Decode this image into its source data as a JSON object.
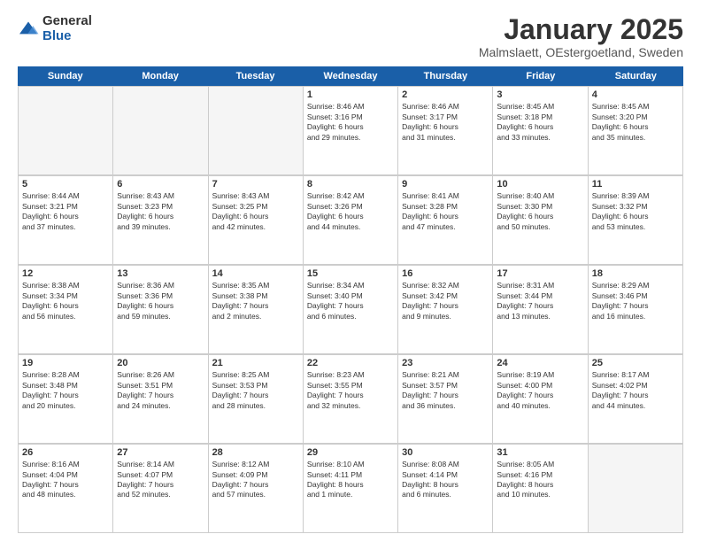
{
  "logo": {
    "general": "General",
    "blue": "Blue"
  },
  "title": "January 2025",
  "subtitle": "Malmslaett, OEstergoetland, Sweden",
  "header_days": [
    "Sunday",
    "Monday",
    "Tuesday",
    "Wednesday",
    "Thursday",
    "Friday",
    "Saturday"
  ],
  "weeks": [
    [
      {
        "day": "",
        "info": ""
      },
      {
        "day": "",
        "info": ""
      },
      {
        "day": "",
        "info": ""
      },
      {
        "day": "1",
        "info": "Sunrise: 8:46 AM\nSunset: 3:16 PM\nDaylight: 6 hours\nand 29 minutes."
      },
      {
        "day": "2",
        "info": "Sunrise: 8:46 AM\nSunset: 3:17 PM\nDaylight: 6 hours\nand 31 minutes."
      },
      {
        "day": "3",
        "info": "Sunrise: 8:45 AM\nSunset: 3:18 PM\nDaylight: 6 hours\nand 33 minutes."
      },
      {
        "day": "4",
        "info": "Sunrise: 8:45 AM\nSunset: 3:20 PM\nDaylight: 6 hours\nand 35 minutes."
      }
    ],
    [
      {
        "day": "5",
        "info": "Sunrise: 8:44 AM\nSunset: 3:21 PM\nDaylight: 6 hours\nand 37 minutes."
      },
      {
        "day": "6",
        "info": "Sunrise: 8:43 AM\nSunset: 3:23 PM\nDaylight: 6 hours\nand 39 minutes."
      },
      {
        "day": "7",
        "info": "Sunrise: 8:43 AM\nSunset: 3:25 PM\nDaylight: 6 hours\nand 42 minutes."
      },
      {
        "day": "8",
        "info": "Sunrise: 8:42 AM\nSunset: 3:26 PM\nDaylight: 6 hours\nand 44 minutes."
      },
      {
        "day": "9",
        "info": "Sunrise: 8:41 AM\nSunset: 3:28 PM\nDaylight: 6 hours\nand 47 minutes."
      },
      {
        "day": "10",
        "info": "Sunrise: 8:40 AM\nSunset: 3:30 PM\nDaylight: 6 hours\nand 50 minutes."
      },
      {
        "day": "11",
        "info": "Sunrise: 8:39 AM\nSunset: 3:32 PM\nDaylight: 6 hours\nand 53 minutes."
      }
    ],
    [
      {
        "day": "12",
        "info": "Sunrise: 8:38 AM\nSunset: 3:34 PM\nDaylight: 6 hours\nand 56 minutes."
      },
      {
        "day": "13",
        "info": "Sunrise: 8:36 AM\nSunset: 3:36 PM\nDaylight: 6 hours\nand 59 minutes."
      },
      {
        "day": "14",
        "info": "Sunrise: 8:35 AM\nSunset: 3:38 PM\nDaylight: 7 hours\nand 2 minutes."
      },
      {
        "day": "15",
        "info": "Sunrise: 8:34 AM\nSunset: 3:40 PM\nDaylight: 7 hours\nand 6 minutes."
      },
      {
        "day": "16",
        "info": "Sunrise: 8:32 AM\nSunset: 3:42 PM\nDaylight: 7 hours\nand 9 minutes."
      },
      {
        "day": "17",
        "info": "Sunrise: 8:31 AM\nSunset: 3:44 PM\nDaylight: 7 hours\nand 13 minutes."
      },
      {
        "day": "18",
        "info": "Sunrise: 8:29 AM\nSunset: 3:46 PM\nDaylight: 7 hours\nand 16 minutes."
      }
    ],
    [
      {
        "day": "19",
        "info": "Sunrise: 8:28 AM\nSunset: 3:48 PM\nDaylight: 7 hours\nand 20 minutes."
      },
      {
        "day": "20",
        "info": "Sunrise: 8:26 AM\nSunset: 3:51 PM\nDaylight: 7 hours\nand 24 minutes."
      },
      {
        "day": "21",
        "info": "Sunrise: 8:25 AM\nSunset: 3:53 PM\nDaylight: 7 hours\nand 28 minutes."
      },
      {
        "day": "22",
        "info": "Sunrise: 8:23 AM\nSunset: 3:55 PM\nDaylight: 7 hours\nand 32 minutes."
      },
      {
        "day": "23",
        "info": "Sunrise: 8:21 AM\nSunset: 3:57 PM\nDaylight: 7 hours\nand 36 minutes."
      },
      {
        "day": "24",
        "info": "Sunrise: 8:19 AM\nSunset: 4:00 PM\nDaylight: 7 hours\nand 40 minutes."
      },
      {
        "day": "25",
        "info": "Sunrise: 8:17 AM\nSunset: 4:02 PM\nDaylight: 7 hours\nand 44 minutes."
      }
    ],
    [
      {
        "day": "26",
        "info": "Sunrise: 8:16 AM\nSunset: 4:04 PM\nDaylight: 7 hours\nand 48 minutes."
      },
      {
        "day": "27",
        "info": "Sunrise: 8:14 AM\nSunset: 4:07 PM\nDaylight: 7 hours\nand 52 minutes."
      },
      {
        "day": "28",
        "info": "Sunrise: 8:12 AM\nSunset: 4:09 PM\nDaylight: 7 hours\nand 57 minutes."
      },
      {
        "day": "29",
        "info": "Sunrise: 8:10 AM\nSunset: 4:11 PM\nDaylight: 8 hours\nand 1 minute."
      },
      {
        "day": "30",
        "info": "Sunrise: 8:08 AM\nSunset: 4:14 PM\nDaylight: 8 hours\nand 6 minutes."
      },
      {
        "day": "31",
        "info": "Sunrise: 8:05 AM\nSunset: 4:16 PM\nDaylight: 8 hours\nand 10 minutes."
      },
      {
        "day": "",
        "info": ""
      }
    ]
  ]
}
